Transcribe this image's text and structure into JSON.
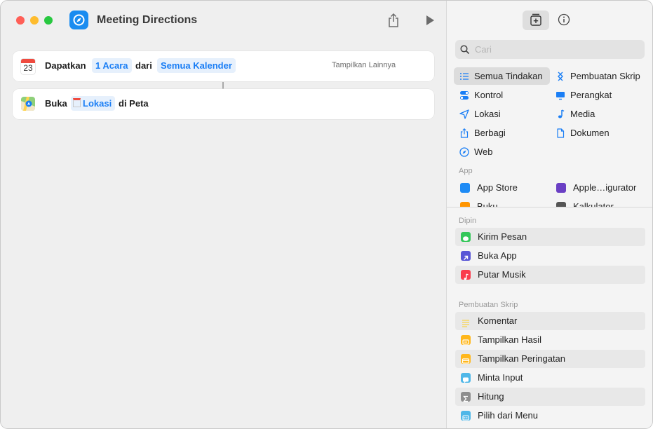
{
  "window": {
    "title": "Meeting Directions"
  },
  "colors": {
    "accent": "#1a7ef5",
    "red": "#ff5f57",
    "yellow": "#febc2e",
    "green": "#28c840"
  },
  "actions": [
    {
      "icon": "calendar-icon",
      "calendar_day": "23",
      "verb": "Dapatkan",
      "count_token": "1 Acara",
      "connector": "dari",
      "source_token": "Semua Kalender",
      "more_label": "Tampilkan Lainnya"
    },
    {
      "icon": "maps-icon",
      "verb": "Buka",
      "location_token": "Lokasi",
      "suffix": "di Peta"
    }
  ],
  "sidebar": {
    "search_placeholder": "Cari",
    "categories_left": [
      {
        "label": "Semua Tindakan",
        "icon": "list-icon",
        "selected": true
      },
      {
        "label": "Kontrol",
        "icon": "toggle-icon"
      },
      {
        "label": "Lokasi",
        "icon": "location-arrow-icon"
      },
      {
        "label": "Berbagi",
        "icon": "share-icon"
      },
      {
        "label": "Web",
        "icon": "compass-icon"
      }
    ],
    "categories_right": [
      {
        "label": "Pembuatan Skrip",
        "icon": "scripting-icon"
      },
      {
        "label": "Perangkat",
        "icon": "monitor-icon"
      },
      {
        "label": "Media",
        "icon": "music-note-icon"
      },
      {
        "label": "Dokumen",
        "icon": "document-icon"
      }
    ],
    "apps_heading": "App",
    "apps": [
      {
        "label": "App Store",
        "color": "#1e8bf5"
      },
      {
        "label": "Apple…igurator",
        "color": "#6a3fc4"
      },
      {
        "label": "Buku",
        "color": "#ff9500"
      },
      {
        "label": "Kalkulator",
        "color": "#555555"
      }
    ],
    "pinned_heading": "Dipin",
    "pinned": [
      {
        "label": "Kirim Pesan",
        "color": "#34c759",
        "icon": "message-bubble-icon"
      },
      {
        "label": "Buka App",
        "color": "#5856d6",
        "icon": "arrow-up-right-icon"
      },
      {
        "label": "Putar Musik",
        "color": "#fa3c4c",
        "icon": "music-note-icon"
      }
    ],
    "scripting_heading": "Pembuatan Skrip",
    "scripting": [
      {
        "label": "Komentar",
        "color": "#f7d34a",
        "icon": "lines-icon"
      },
      {
        "label": "Tampilkan Hasil",
        "color": "#ffb71b",
        "icon": "result-icon"
      },
      {
        "label": "Tampilkan Peringatan",
        "color": "#ffb71b",
        "icon": "alert-icon"
      },
      {
        "label": "Minta Input",
        "color": "#4fb7e8",
        "icon": "input-bubble-icon"
      },
      {
        "label": "Hitung",
        "color": "#8e8e8e",
        "icon": "sigma-icon"
      },
      {
        "label": "Pilih dari Menu",
        "color": "#4fb7e8",
        "icon": "menu-icon"
      }
    ]
  }
}
